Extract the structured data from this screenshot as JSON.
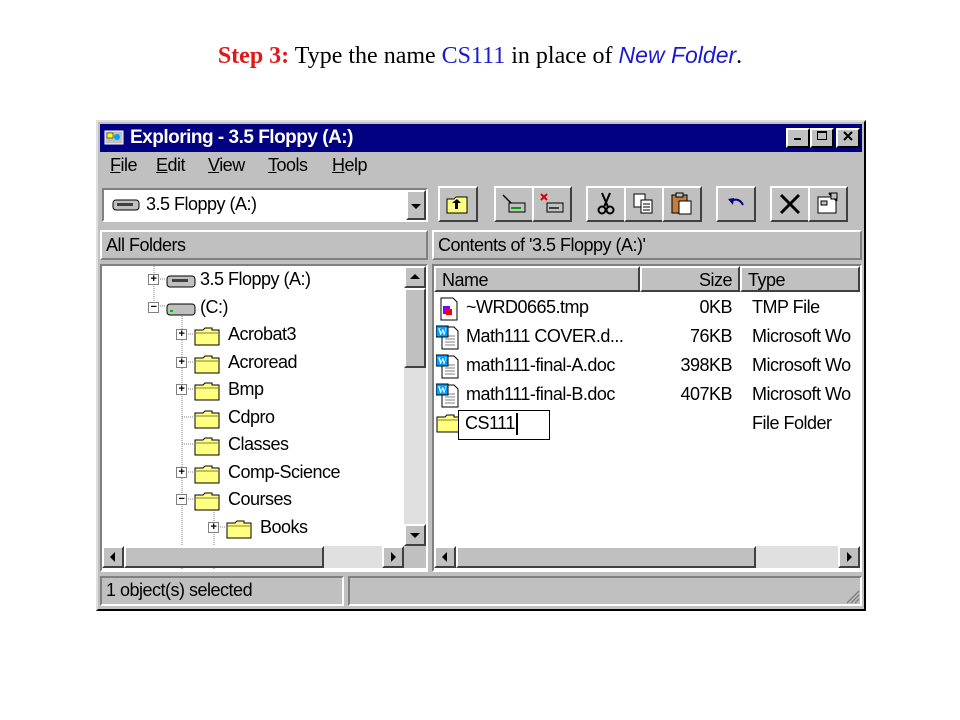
{
  "caption": {
    "step": "Step 3:",
    "part1": " Type the name ",
    "name": "CS111",
    "part2": " in place of ",
    "folder_word": "New Folder",
    "end": "."
  },
  "window": {
    "title": "Exploring - 3.5 Floppy (A:)",
    "menu": [
      "File",
      "Edit",
      "View",
      "Tools",
      "Help"
    ],
    "address": "3.5 Floppy (A:)",
    "left_header": "All Folders",
    "right_header": "Contents of '3.5 Floppy (A:)'",
    "tree": [
      {
        "label": "3.5 Floppy (A:)",
        "icon": "floppy-drive-icon",
        "expander": "+"
      },
      {
        "label": "(C:)",
        "icon": "hard-drive-icon",
        "expander": "−"
      },
      {
        "label": "Acrobat3",
        "icon": "folder-icon",
        "expander": "+"
      },
      {
        "label": "Acroread",
        "icon": "folder-icon",
        "expander": "+"
      },
      {
        "label": "Bmp",
        "icon": "folder-icon",
        "expander": "+"
      },
      {
        "label": "Cdpro",
        "icon": "folder-icon",
        "expander": ""
      },
      {
        "label": "Classes",
        "icon": "folder-icon",
        "expander": ""
      },
      {
        "label": "Comp-Science",
        "icon": "folder-icon",
        "expander": "+"
      },
      {
        "label": "Courses",
        "icon": "folder-icon",
        "expander": "−"
      },
      {
        "label": "Books",
        "icon": "folder-icon",
        "expander": "+"
      }
    ],
    "columns": [
      "Name",
      "Size",
      "Type"
    ],
    "files": [
      {
        "name": "~WRD0665.tmp",
        "size": "0KB",
        "type": "TMP File",
        "icon": "tmp-file-icon"
      },
      {
        "name": "Math111 COVER.d...",
        "size": "76KB",
        "type": "Microsoft Wo",
        "icon": "word-doc-icon"
      },
      {
        "name": "math111-final-A.doc",
        "size": "398KB",
        "type": "Microsoft Wo",
        "icon": "word-doc-icon"
      },
      {
        "name": "math111-final-B.doc",
        "size": "407KB",
        "type": "Microsoft Wo",
        "icon": "word-doc-icon"
      }
    ],
    "renaming": {
      "name": "CS111",
      "size": "",
      "type": "File Folder",
      "icon": "folder-icon"
    },
    "status": "1 object(s) selected"
  },
  "colors": {
    "title_bar": "#000080",
    "face": "#c0c0c0",
    "step_red": "#e01818",
    "caption_blue": "#1a1acc"
  }
}
